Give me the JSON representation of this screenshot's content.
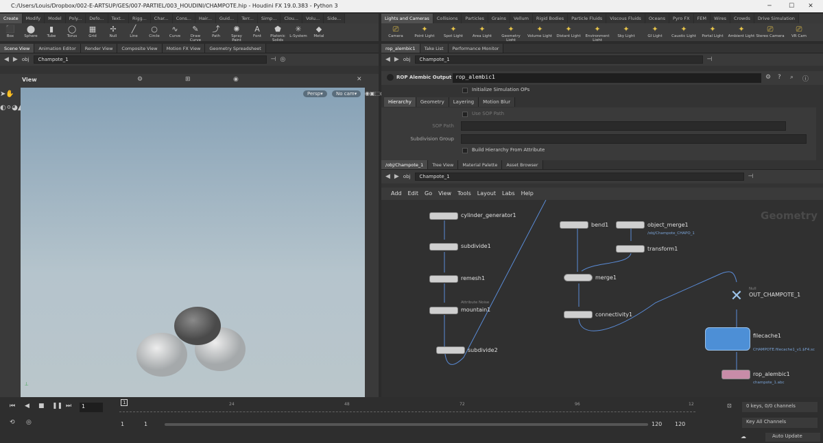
{
  "window": {
    "title": "C:/Users/Louis/Dropbox/002-E-ARTSUP/GES/007-PARTIEL/003_HOUDINI/CHAMPOTE.hip - Houdini FX 19.0.383 - Python 3"
  },
  "left_shelf": {
    "tabs": [
      "Create",
      "Modify",
      "Model",
      "Poly...",
      "Defo...",
      "Text...",
      "Rigg...",
      "Char...",
      "Cons...",
      "Hair...",
      "Guid...",
      "Terr...",
      "Simp...",
      "Clou...",
      "Volu...",
      "Side..."
    ],
    "tools": [
      "Box",
      "Sphere",
      "Tube",
      "Torus",
      "Grid",
      "Null",
      "Line",
      "Circle",
      "Curve",
      "Draw Curve",
      "Path",
      "Spray Paint",
      "Font",
      "Platonic Solids",
      "L-System",
      "Metal"
    ]
  },
  "right_shelf": {
    "tabs": [
      "Lights and Cameras",
      "Collisions",
      "Particles",
      "Grains",
      "Vellum",
      "Rigid Bodies",
      "Particle Fluids",
      "Viscous Fluids",
      "Oceans",
      "Pyro FX",
      "FEM",
      "Wires",
      "Crowds",
      "Drive Simulation"
    ],
    "tools": [
      "Camera",
      "Point Light",
      "Spot Light",
      "Area Light",
      "Geometry Light",
      "Volume Light",
      "Distant Light",
      "Environment Light",
      "Sky Light",
      "GI Light",
      "Caustic Light",
      "Portal Light",
      "Ambient Light",
      "Stereo Camera",
      "VR Cam"
    ]
  },
  "left_pane": {
    "tabs": [
      "Scene View",
      "Animation Editor",
      "Render View",
      "Composite View",
      "Motion FX View",
      "Geometry Spreadsheet"
    ],
    "path_root": "obj",
    "path_node": "Champote_1",
    "view_label": "View",
    "persp": "Persp▾",
    "cam": "No cam▾"
  },
  "params_pane": {
    "tabs": [
      "rop_alembic1",
      "Take List",
      "Performance Monitor"
    ],
    "path_root": "obj",
    "path_node": "Champote_1",
    "node_type": "ROP Alembic Output",
    "node_name": "rop_alembic1",
    "init_sim": "Initialize Simulation OPs",
    "subtabs": [
      "Hierarchy",
      "Geometry",
      "Layering",
      "Motion Blur"
    ],
    "use_sop_path": "Use SOP Path",
    "sop_path_label": "SOP Path",
    "subdiv_label": "Subdivision Group",
    "build_hierarchy": "Build Hierarchy From Attribute"
  },
  "network_pane": {
    "tabs": [
      "/obj/Champote_1",
      "Tree View",
      "Material Palette",
      "Asset Browser"
    ],
    "path_root": "obj",
    "path_node": "Champote_1",
    "menu": [
      "Add",
      "Edit",
      "Go",
      "View",
      "Tools",
      "Layout",
      "Labs",
      "Help"
    ],
    "context": "Geometry",
    "nodes": {
      "cylinder": "cylinder_generator1",
      "subdivide1": "subdivide1",
      "remesh1": "remesh1",
      "mountain_cap": "Attribute Noise",
      "mountain1": "mountain1",
      "subdivide2": "subdivide2",
      "bend1": "bend1",
      "object_merge": "object_merge1",
      "object_merge_sub": "/obj/Champote_CHAPO_1",
      "transform1": "transform1",
      "merge1": "merge1",
      "connectivity1": "connectivity1",
      "out_cap": "Null",
      "out": "OUT_CHAMPOTE_1",
      "filecache": "filecache1",
      "filecache_sub": "CHAMPOTE.filecache1_v1.$F4.sc",
      "rop": "rop_alembic1",
      "rop_sub": "champote_1.abc"
    }
  },
  "timeline": {
    "current_frame": "1",
    "marker": "1",
    "ticks": [
      "24",
      "48",
      "72",
      "96",
      "12"
    ],
    "start": "1",
    "start2": "1",
    "end": "120",
    "end2": "120",
    "keys": "0 keys, 0/0 channels",
    "key_all": "Key All Channels",
    "auto_update": "Auto Update"
  }
}
